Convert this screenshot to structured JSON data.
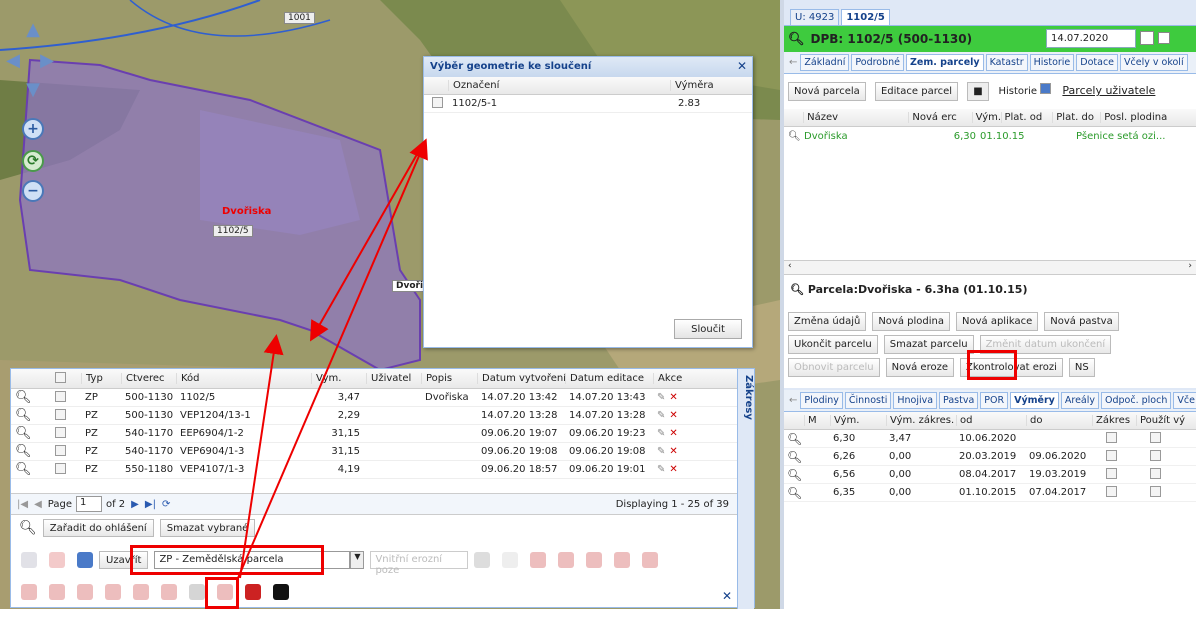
{
  "map": {
    "label_1001": "1001",
    "parcel_name": "Dvořiska",
    "parcel_code": "1102/5",
    "popup_label": "Dvořis"
  },
  "dialog": {
    "title": "Výběr geometrie ke sloučení",
    "col1": "Označení",
    "col2": "Výměra",
    "row": {
      "code": "1102/5-1",
      "area": "2.83"
    },
    "merge_button": "Sloučit"
  },
  "grid": {
    "headers": [
      "Typ",
      "Čtverec",
      "Kód",
      "Vým.",
      "Uživatel",
      "Popis",
      "Datum vytvoření",
      "Datum editace",
      "Akce"
    ],
    "rows": [
      {
        "typ": "ZP",
        "ctverec": "500-1130",
        "kod": "1102/5",
        "vym": "3,47",
        "uzivatel": "",
        "popis": "Dvořiska",
        "vytvoreni": "14.07.20 13:42",
        "editace": "14.07.20 13:43"
      },
      {
        "typ": "PZ",
        "ctverec": "500-1130",
        "kod": "VEP1204/13-1",
        "vym": "2,29",
        "uzivatel": "",
        "popis": "",
        "vytvoreni": "14.07.20 13:28",
        "editace": "14.07.20 13:28"
      },
      {
        "typ": "PZ",
        "ctverec": "540-1170",
        "kod": "EEP6904/1-2",
        "vym": "31,15",
        "uzivatel": "",
        "popis": "",
        "vytvoreni": "09.06.20 19:07",
        "editace": "09.06.20 19:23"
      },
      {
        "typ": "PZ",
        "ctverec": "540-1170",
        "kod": "VEP6904/1-3",
        "vym": "31,15",
        "uzivatel": "",
        "popis": "",
        "vytvoreni": "09.06.20 19:08",
        "editace": "09.06.20 19:08"
      },
      {
        "typ": "PZ",
        "ctverec": "550-1180",
        "kod": "VEP4107/1-3",
        "vym": "4,19",
        "uzivatel": "",
        "popis": "",
        "vytvoreni": "09.06.20 18:57",
        "editace": "09.06.20 19:01"
      }
    ],
    "pager": {
      "page_label": "Page",
      "page": "1",
      "of": "of 2",
      "displaying": "Displaying 1 - 25 of 39"
    },
    "btn_assign": "Zařadit do ohlášení",
    "btn_delete": "Smazat vybrané",
    "btn_close": "Uzavřít",
    "select_type": "ZP - Zemědělská parcela",
    "select_erosion": "Vnitřní erozní poze",
    "side_tab": "Zákresy"
  },
  "right": {
    "tabs": [
      "U: 4923",
      "1102/5"
    ],
    "header": "DPB: 1102/5 (500-1130)",
    "date": "14.07.2020",
    "subtabs": [
      "Základní",
      "Podrobné",
      "Zem. parcely",
      "Katastr",
      "Historie",
      "Dotace",
      "Včely v okolí"
    ],
    "btn_new_parcel": "Nová parcela",
    "btn_edit_parcel": "Editace parcel",
    "history_label": "Historie",
    "user_parcels": "Parcely uživatele",
    "parcel_headers": [
      "Název",
      "Nová erc",
      "Vým.",
      "Plat. od",
      "Plat. do",
      "Posl. plodina"
    ],
    "parcel_row": {
      "name": "Dvořiska",
      "vym": "6,30",
      "od": "01.10.15",
      "plodina": "Pšenice setá ozi..."
    },
    "parcel_title": "Parcela:Dvořiska - 6.3ha (01.10.15)",
    "actions": [
      "Změna údajů",
      "Nová plodina",
      "Nová aplikace",
      "Nová pastva",
      "Ukončit parcelu",
      "Smazat parcelu",
      "Změnit datum ukončení",
      "Obnovit parcelu",
      "Nová eroze",
      "Zkontrolovat erozi",
      "NS"
    ],
    "subtabs2": [
      "Plodiny",
      "Činnosti",
      "Hnojiva",
      "Pastva",
      "POR",
      "Výměry",
      "Areály",
      "Odpoč. ploch",
      "Vče"
    ],
    "area_headers": [
      "M",
      "Vým.",
      "Vým. zákres.",
      "od",
      "do",
      "Zákres",
      "Použít vým"
    ],
    "area_rows": [
      {
        "vym": "6,30",
        "zakres": "3,47",
        "od": "10.06.2020",
        "do": ""
      },
      {
        "vym": "6,26",
        "zakres": "0,00",
        "od": "20.03.2019",
        "do": "09.06.2020"
      },
      {
        "vym": "6,56",
        "zakres": "0,00",
        "od": "08.04.2017",
        "do": "19.03.2019"
      },
      {
        "vym": "6,35",
        "zakres": "0,00",
        "od": "01.10.2015",
        "do": "07.04.2017"
      }
    ]
  }
}
